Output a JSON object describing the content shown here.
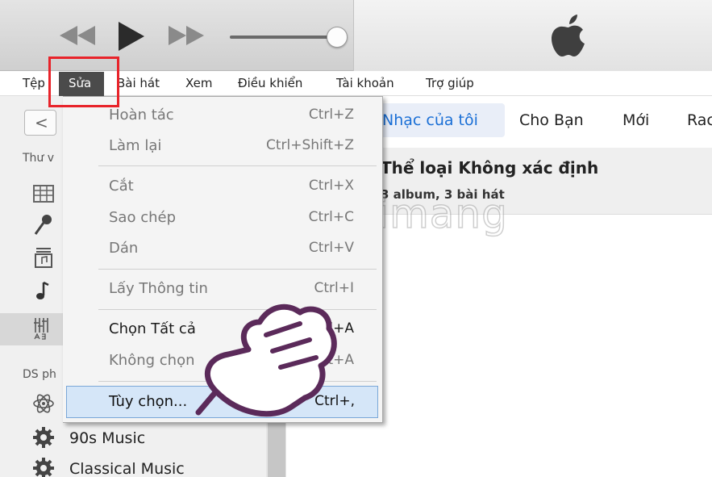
{
  "menubar": {
    "items": [
      "Tệp",
      "Sửa",
      "Bài hát",
      "Xem",
      "Điều khiển",
      "Tài khoản",
      "Trợ giúp"
    ]
  },
  "tabs": {
    "active": "Nhạc của tôi",
    "for_you": "Cho Bạn",
    "new": "Mới",
    "radio_partial": "Rac"
  },
  "sidebar": {
    "library_label": "Thư v",
    "playlists_label": "DS ph",
    "playlists": [
      "90s Music",
      "Classical Music"
    ]
  },
  "content": {
    "genre_title": "Thể loại Không xác định",
    "genre_sub": "3 album, 3 bài hát"
  },
  "edit_menu": {
    "items": [
      {
        "label": "Hoàn tác",
        "shortcut": "Ctrl+Z",
        "enabled": false
      },
      {
        "label": "Làm lại",
        "shortcut": "Ctrl+Shift+Z",
        "enabled": false
      },
      {
        "label": "Cắt",
        "shortcut": "Ctrl+X",
        "enabled": false
      },
      {
        "label": "Sao chép",
        "shortcut": "Ctrl+C",
        "enabled": false
      },
      {
        "label": "Dán",
        "shortcut": "Ctrl+V",
        "enabled": false
      },
      {
        "label": "Lấy Thông tin",
        "shortcut": "Ctrl+I",
        "enabled": false
      },
      {
        "label": "Chọn Tất cả",
        "shortcut": "Ctrl+A",
        "enabled": true
      },
      {
        "label": "Không chọn",
        "shortcut": "Ctrl+Shift+A",
        "enabled": false
      },
      {
        "label": "Tùy chọn...",
        "shortcut": "Ctrl+,",
        "enabled": true
      }
    ]
  },
  "player": {
    "volume_fraction": 0.9
  },
  "watermark": {
    "text": "uantrimang"
  },
  "colors": {
    "highlight_box": "#e8232a",
    "selected_menu_bg": "#4b4b4b",
    "active_tab_text": "#1a6fd6",
    "hover_item_bg": "#d5e6f8"
  }
}
